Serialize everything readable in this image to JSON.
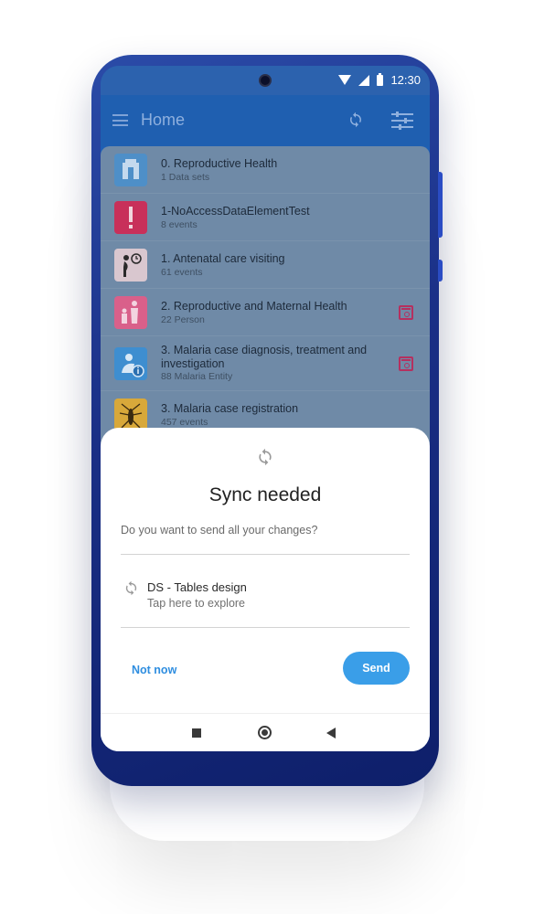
{
  "status_bar": {
    "time": "12:30"
  },
  "app_bar": {
    "title": "Home"
  },
  "programs": [
    {
      "title": "0. Reproductive Health",
      "subtitle": "1 Data sets",
      "icon": "clinic-icon",
      "icon_color": "#4e8fc8",
      "calendar": false
    },
    {
      "title": "1-NoAccessDataElementTest",
      "subtitle": "8 events",
      "icon": "exclamation-icon",
      "icon_color": "#c8305a",
      "calendar": false
    },
    {
      "title": "1. Antenatal care visiting",
      "subtitle": "61 events",
      "icon": "pregnant-clock-icon",
      "icon_color": "#d9c7cf",
      "calendar": false
    },
    {
      "title": "2. Reproductive and Maternal Health",
      "subtitle": "22 Person",
      "icon": "mother-child-icon",
      "icon_color": "#d9608a",
      "calendar": true
    },
    {
      "title": "3. Malaria case diagnosis, treatment and investigation",
      "subtitle": "88 Malaria Entity",
      "icon": "diagnosis-icon",
      "icon_color": "#3e8ed0",
      "calendar": true
    },
    {
      "title": "3. Malaria case registration",
      "subtitle": "457 events",
      "icon": "mosquito-icon",
      "icon_color": "#d8a83a",
      "calendar": false
    }
  ],
  "dialog": {
    "title": "Sync needed",
    "message": "Do you want to send all your changes?",
    "item_title": "DS - Tables design",
    "item_subtitle": "Tap here to explore",
    "negative_label": "Not now",
    "positive_label": "Send"
  },
  "colors": {
    "primary": "#1f5fb0",
    "accent": "#3a9ee8",
    "phone_body": "#1a2f86"
  }
}
